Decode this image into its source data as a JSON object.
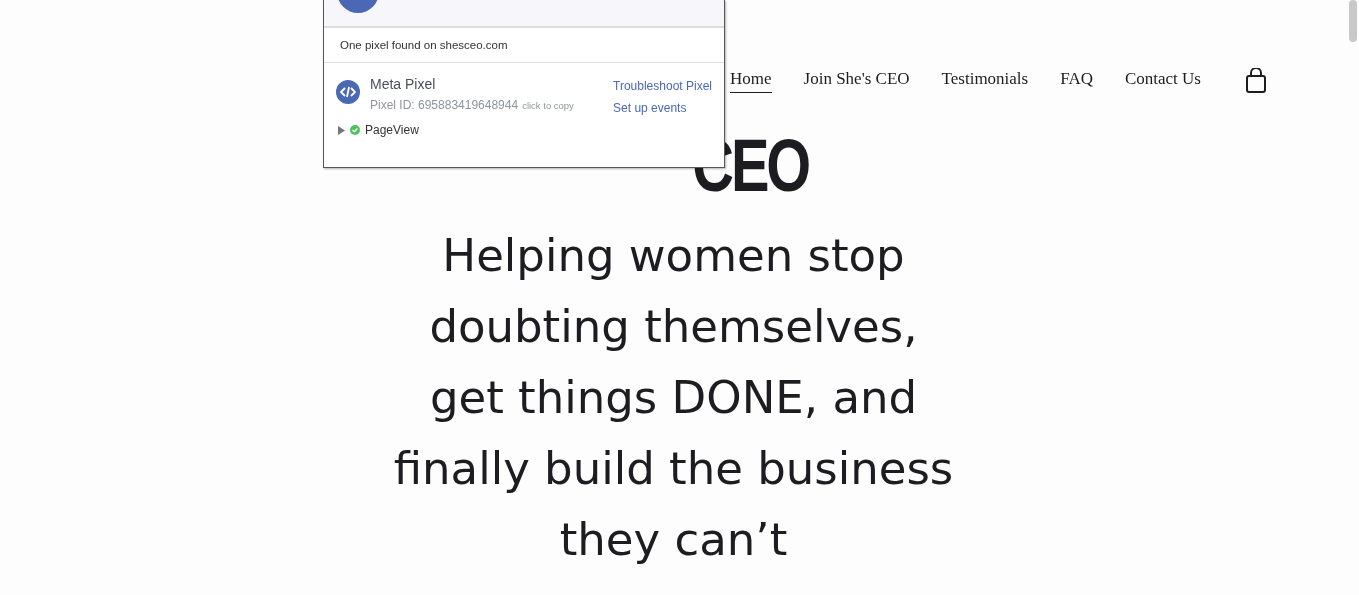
{
  "pixel_helper": {
    "found_text": "One pixel found on shesceo.com",
    "pixels": [
      {
        "name": "Meta Pixel",
        "id_label": "Pixel ID: 695883419648944",
        "copy_hint": "click to copy",
        "links": [
          "Troubleshoot Pixel",
          "Set up events"
        ],
        "events": [
          {
            "name": "PageView",
            "expanded": false,
            "ok": true
          }
        ]
      }
    ]
  },
  "nav": [
    {
      "label": "Home",
      "selected": true
    },
    {
      "label": "Join She's CEO",
      "selected": false
    },
    {
      "label": "Testimonials",
      "selected": false
    },
    {
      "label": "FAQ",
      "selected": false
    },
    {
      "label": "Contact Us",
      "selected": false
    }
  ],
  "hero": {
    "title": "CEO",
    "tagline": "Helping women stop doubting themselves, get things DONE, and finally build the business they can’t"
  }
}
